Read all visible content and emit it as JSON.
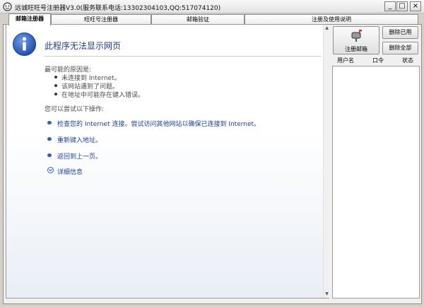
{
  "window": {
    "title": "远诚旺旺号注册器V3.0(服务联系电话:13302304103,QQ:517074120)",
    "buttons": {
      "minimize": "_",
      "maximize": "□",
      "close": "×"
    }
  },
  "tabs": [
    {
      "label": "邮箱注册器",
      "active": true
    },
    {
      "label": "旺旺号注册器",
      "active": false
    },
    {
      "label": "邮箱验证",
      "active": false
    },
    {
      "label": "注册及使用说明",
      "active": false
    }
  ],
  "browser": {
    "error_title": "此程序无法显示网页",
    "reason_title": "最可能的原因是:",
    "reasons": [
      "未连接到 Internet。",
      "该网站遇到了问题。",
      "在地址中可能存在键入错误。"
    ],
    "try_title": "您可以尝试以下操作:",
    "actions": [
      "检查您的 Internet 连接。尝试访问其他网站以确保已连接到 Internet。",
      "重新键入地址。",
      "返回到上一页。"
    ],
    "details_label": "详细信息"
  },
  "controls": {
    "register_button": "注册邮箱",
    "delete_used_button": "删除已用",
    "delete_all_button": "删除全部"
  },
  "account_list": {
    "columns": [
      "用户名",
      "口令",
      "状态"
    ],
    "rows": []
  },
  "colors": {
    "link": "#1c3f94",
    "title_blue": "#1f3a87",
    "info_icon": "#1f4fb0"
  }
}
